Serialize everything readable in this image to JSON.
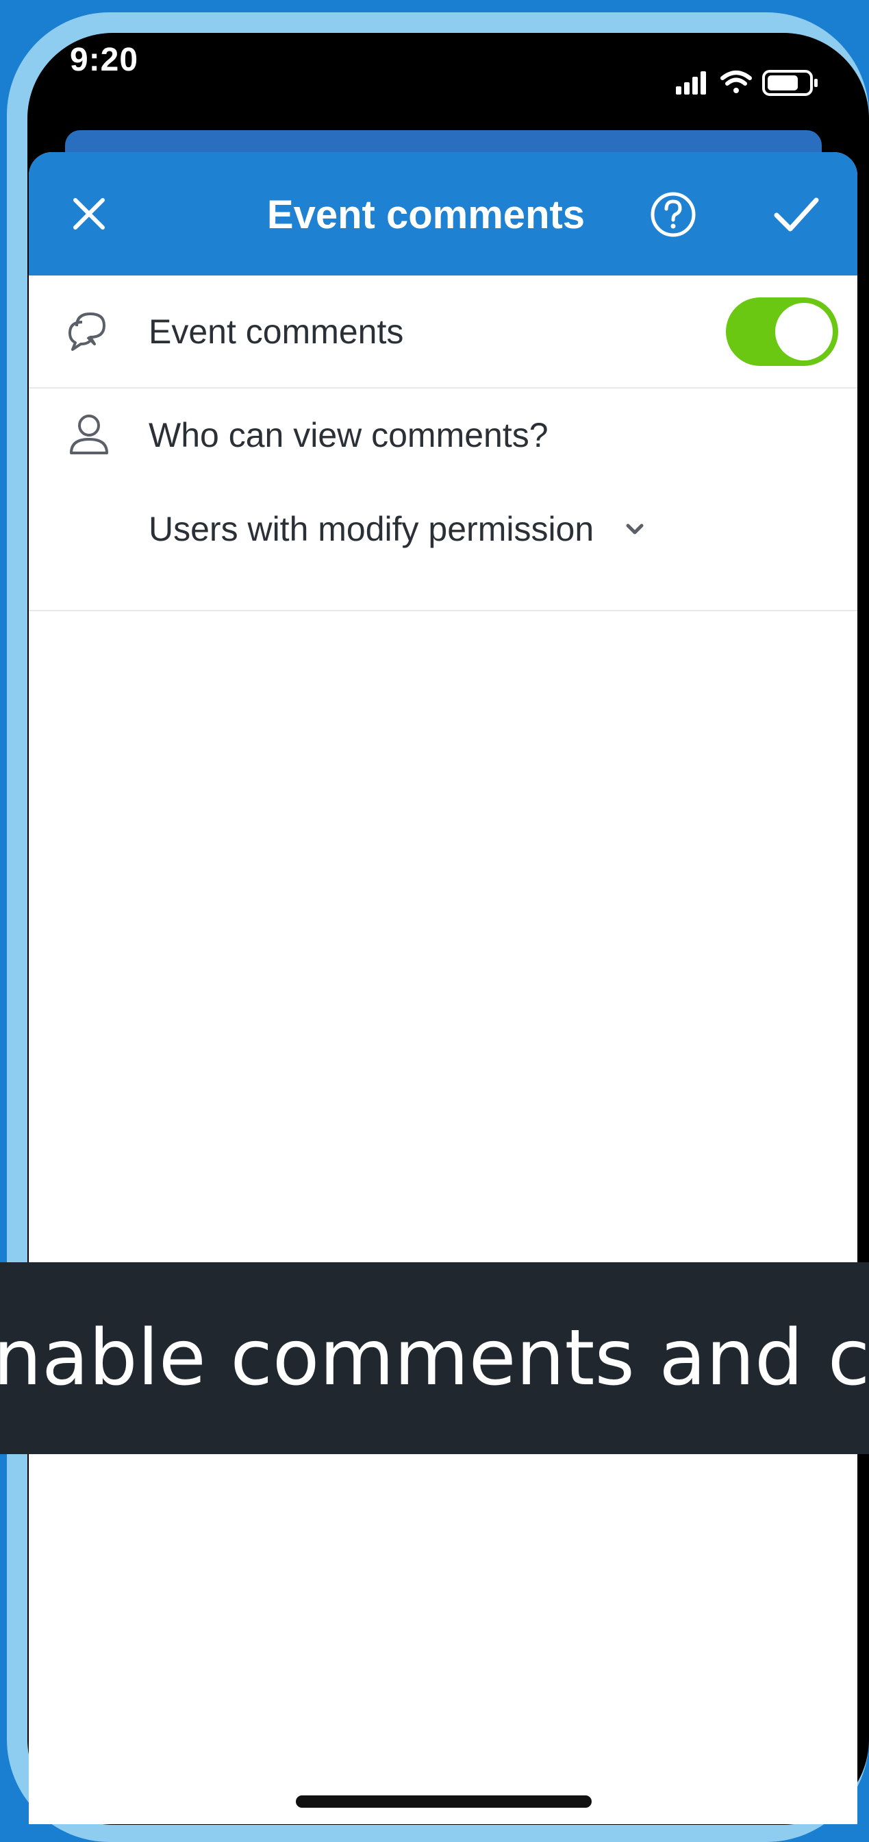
{
  "status_bar": {
    "time": "9:20"
  },
  "header": {
    "title": "Event comments"
  },
  "settings": {
    "comments_toggle": {
      "label": "Event comments",
      "enabled": true
    },
    "visibility": {
      "label": "Who can view comments?",
      "selected": "Users with modify permission"
    }
  },
  "caption": {
    "text": "nable comments and confir"
  },
  "colors": {
    "header": "#1e81d2",
    "toggle_on": "#6ac712",
    "caption_bg": "#20272e",
    "frame": "#8fcdf0"
  },
  "icons": [
    "close-icon",
    "help-icon",
    "checkmark-icon",
    "comments-icon",
    "person-icon",
    "chevron-down-icon",
    "signal-icon",
    "wifi-icon",
    "battery-icon"
  ]
}
